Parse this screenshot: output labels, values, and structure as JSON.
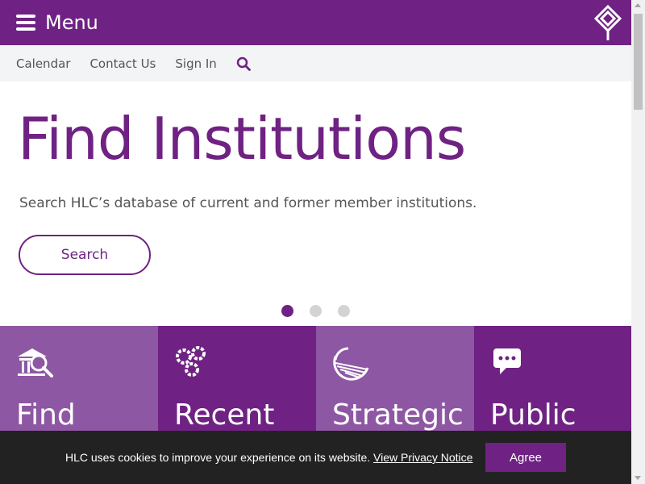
{
  "header": {
    "menu_label": "Menu",
    "logo_icon": "hlc-diamond-logo"
  },
  "utility_nav": {
    "items": [
      {
        "label": "Calendar"
      },
      {
        "label": "Contact Us"
      },
      {
        "label": "Sign In"
      }
    ],
    "search_icon": "search-icon"
  },
  "hero": {
    "title": "Find Institutions",
    "description": "Search HLC’s database of current and former member institutions.",
    "button_label": "Search",
    "carousel_dots": 3,
    "active_dot": 1
  },
  "tiles": [
    {
      "title": "Find",
      "icon": "institution-search-icon"
    },
    {
      "title": "Recent",
      "icon": "gears-icon"
    },
    {
      "title": "Strategic",
      "icon": "fan-shell-icon"
    },
    {
      "title": "Public",
      "icon": "chat-bubble-icon"
    }
  ],
  "cookie_banner": {
    "text": "HLC uses cookies to improve your experience on its website.",
    "link_label": "View Privacy Notice",
    "button_label": "Agree"
  },
  "colors": {
    "brand_purple": "#6f2283",
    "light_purple": "#8e57a3",
    "nav_bg": "#f3f4f6",
    "cookie_bg": "#222222"
  }
}
